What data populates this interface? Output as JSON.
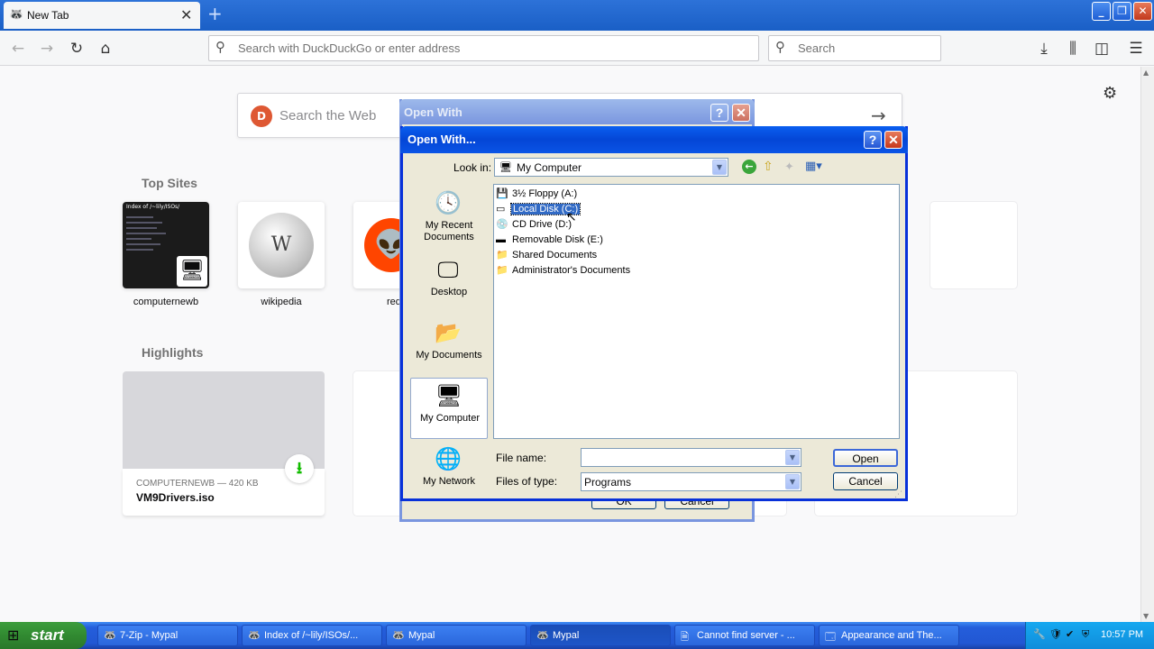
{
  "browser": {
    "tab_title": "New Tab",
    "url_placeholder": "Search with DuckDuckGo or enter address",
    "search_placeholder": "Search"
  },
  "newtab": {
    "web_search_placeholder": "Search the Web",
    "top_sites_heading": "Top Sites",
    "top_sites": [
      {
        "label": "computernewb"
      },
      {
        "label": "wikipedia"
      },
      {
        "label": "redd"
      }
    ],
    "thumb_header": "Index of /~lily/ISOs/",
    "highlights_heading": "Highlights",
    "highlight": {
      "meta": "COMPUTERNEWB — 420 KB",
      "name": "VM9Drivers.iso"
    }
  },
  "bg_dialog": {
    "title": "Open With",
    "ok_label": "OK",
    "cancel_label": "Cancel"
  },
  "dialog": {
    "title": "Open With...",
    "look_in_label": "Look in:",
    "look_in_value": "My Computer",
    "places": [
      {
        "label": "My Recent Documents",
        "icon": "recent-documents-icon"
      },
      {
        "label": "Desktop",
        "icon": "desktop-icon"
      },
      {
        "label": "My Documents",
        "icon": "my-documents-icon"
      },
      {
        "label": "My Computer",
        "icon": "my-computer-icon"
      },
      {
        "label": "My Network",
        "icon": "my-network-icon"
      }
    ],
    "files": [
      {
        "label": "3½ Floppy (A:)",
        "icon": "floppy-drive-icon"
      },
      {
        "label": "Local Disk (C:)",
        "icon": "hard-disk-icon",
        "selected": true
      },
      {
        "label": "CD Drive (D:)",
        "icon": "cd-drive-icon"
      },
      {
        "label": "Removable Disk (E:)",
        "icon": "removable-disk-icon"
      },
      {
        "label": "Shared Documents",
        "icon": "folder-icon"
      },
      {
        "label": "Administrator's Documents",
        "icon": "folder-icon"
      }
    ],
    "file_name_label": "File name:",
    "file_name_value": "",
    "files_of_type_label": "Files of type:",
    "files_of_type_value": "Programs",
    "open_label": "Open",
    "cancel_label": "Cancel"
  },
  "taskbar": {
    "start_label": "start",
    "tasks": [
      {
        "label": "7-Zip - Mypal"
      },
      {
        "label": "Index of /~lily/ISOs/..."
      },
      {
        "label": "Mypal"
      },
      {
        "label": "Mypal",
        "active": true
      },
      {
        "label": "Cannot find server - ..."
      },
      {
        "label": "Appearance and The..."
      }
    ],
    "clock": "10:57 PM"
  },
  "colors": {
    "xp_title_blue": "#0a5ff0",
    "selection_blue": "#316ac5",
    "start_green": "#318a31",
    "taskbar_blue": "#245edb"
  }
}
